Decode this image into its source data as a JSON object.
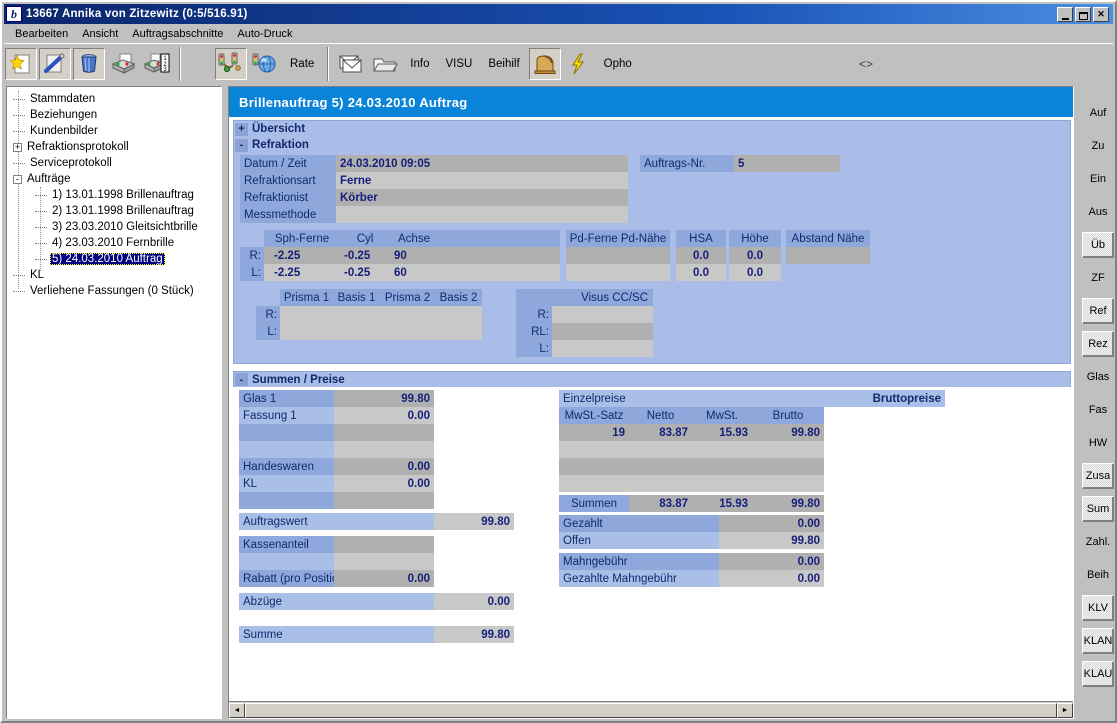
{
  "window": {
    "title": "13667  Annika von Zitzewitz   (0:5/516.91)",
    "icon": "app-icon",
    "buttons": {
      "minimize": "_",
      "maximize": "□",
      "close": "✕"
    }
  },
  "menubar": {
    "items": [
      "Bearbeiten",
      "Ansicht",
      "Auftragsabschnitte",
      "Auto-Druck"
    ]
  },
  "toolbar": {
    "icons": [
      {
        "name": "new-document-icon",
        "label": ""
      },
      {
        "name": "edit-pen-icon",
        "label": ""
      },
      {
        "name": "trash-bin-icon",
        "label": ""
      },
      {
        "name": "print-icon",
        "label": ""
      },
      {
        "name": "print-numbered-icon",
        "label": ""
      }
    ],
    "group2": [
      {
        "name": "traffic-light-network-icon",
        "label": ""
      },
      {
        "name": "globe-traffic-icon",
        "label": ""
      }
    ],
    "rate_label": "Rate",
    "group3": [
      {
        "name": "mail-envelope-icon",
        "label": ""
      },
      {
        "name": "folder-open-icon",
        "label": ""
      }
    ],
    "info_label": "Info",
    "visu_label": "VISU",
    "beihilf_label": "Beihilf",
    "lens-grinder_icon": "lens-grinder-icon",
    "lightning_icon": "lightning-icon",
    "opho_label": "Opho",
    "overflow_glyph": "<>"
  },
  "tree": {
    "items": [
      {
        "label": "Stammdaten",
        "level": 1,
        "toggle": "",
        "selected": false
      },
      {
        "label": "Beziehungen",
        "level": 1,
        "toggle": "",
        "selected": false
      },
      {
        "label": "Kundenbilder",
        "level": 1,
        "toggle": "",
        "selected": false
      },
      {
        "label": "Refraktionsprotokoll",
        "level": 1,
        "toggle": "+",
        "selected": false
      },
      {
        "label": "Serviceprotokoll",
        "level": 1,
        "toggle": "",
        "selected": false
      },
      {
        "label": "Aufträge",
        "level": 1,
        "toggle": "-",
        "selected": false
      },
      {
        "label": "1)  13.01.1998 Brillenauftrag",
        "level": 2,
        "toggle": "",
        "selected": false
      },
      {
        "label": "2)  13.01.1998 Brillenauftrag",
        "level": 2,
        "toggle": "",
        "selected": false
      },
      {
        "label": "3)  23.03.2010 Gleitsichtbrille",
        "level": 2,
        "toggle": "",
        "selected": false
      },
      {
        "label": "4)  23.03.2010 Fernbrille",
        "level": 2,
        "toggle": "",
        "selected": false
      },
      {
        "label": "5)  24.03.2010 Auftrag",
        "level": 2,
        "toggle": "",
        "selected": true
      },
      {
        "label": "KL",
        "level": 1,
        "toggle": "",
        "selected": false
      },
      {
        "label": "Verliehene Fassungen (0 Stück)",
        "level": 1,
        "toggle": "",
        "selected": false
      }
    ]
  },
  "document": {
    "header": "Brillenauftrag   5)  24.03.2010 Auftrag",
    "sections": {
      "uebersicht": {
        "toggle": "+",
        "title": "Übersicht"
      },
      "refraktion": {
        "toggle": "-",
        "title": "Refraktion"
      },
      "summen": {
        "toggle": "-",
        "title": "Summen / Preise"
      }
    }
  },
  "refraktion": {
    "fields": [
      {
        "label": "Datum / Zeit",
        "value": "24.03.2010 09:05"
      },
      {
        "label": "Refraktionsart",
        "value": "Ferne"
      },
      {
        "label": "Refraktionist",
        "value": "Körber"
      },
      {
        "label": "Messmethode",
        "value": ""
      }
    ],
    "auftrags_nr": {
      "label": "Auftrags-Nr.",
      "value": "5"
    },
    "values_table": {
      "headers": [
        "Sph-Ferne",
        "Cyl",
        "Achse",
        "",
        "Pd-Ferne Pd-Nähe",
        "HSA",
        "Höhe",
        "Abstand Nähe"
      ],
      "rows": [
        {
          "eye": "R:",
          "sph": "-2.25",
          "cyl": "-0.25",
          "achse": "90",
          "pd": "",
          "hsa": "0.0",
          "hoehe": "0.0",
          "abstand": ""
        },
        {
          "eye": "L:",
          "sph": "-2.25",
          "cyl": "-0.25",
          "achse": "60",
          "pd": "",
          "hsa": "0.0",
          "hoehe": "0.0",
          "abstand": ""
        }
      ]
    },
    "prisma": {
      "headers": [
        "Prisma 1",
        "Basis 1",
        "Prisma 2",
        "Basis 2"
      ],
      "rows": [
        {
          "eye": "R:",
          "p1": "",
          "b1": "",
          "p2": "",
          "b2": ""
        },
        {
          "eye": "L:",
          "p1": "",
          "b1": "",
          "p2": "",
          "b2": ""
        }
      ]
    },
    "visus": {
      "title": "Visus CC/SC",
      "rows": [
        {
          "eye": "R:",
          "value": ""
        },
        {
          "eye": "RL:",
          "value": ""
        },
        {
          "eye": "L:",
          "value": ""
        }
      ]
    }
  },
  "summen": {
    "left": {
      "positions": [
        {
          "label": "Glas 1",
          "value": "99.80"
        },
        {
          "label": "Fassung 1",
          "value": "0.00"
        },
        {
          "label": "",
          "value": ""
        },
        {
          "label": "",
          "value": ""
        },
        {
          "label": "Handeswaren",
          "value": "0.00"
        },
        {
          "label": "KL",
          "value": "0.00"
        },
        {
          "label": "",
          "value": ""
        }
      ],
      "auftragswert": {
        "label": "Auftragswert",
        "value": "99.80"
      },
      "kassen": [
        {
          "label": "Kassenanteil",
          "value": ""
        },
        {
          "label": "",
          "value": ""
        },
        {
          "label": "Rabatt (pro Position)",
          "value": "0.00"
        }
      ],
      "abzuege": {
        "label": "Abzüge",
        "value": "0.00"
      },
      "summe": {
        "label": "Summe",
        "value": "99.80"
      }
    },
    "right": {
      "einzelpreise_label": "Einzelpreise",
      "bruttopreise_label": "Bruttopreise",
      "table_headers": [
        "MwSt.-Satz",
        "Netto",
        "MwSt.",
        "Brutto"
      ],
      "table_rows": [
        {
          "satz": "19",
          "netto": "83.87",
          "mwst": "15.93",
          "brutto": "99.80"
        },
        {
          "satz": "",
          "netto": "",
          "mwst": "",
          "brutto": ""
        },
        {
          "satz": "",
          "netto": "",
          "mwst": "",
          "brutto": ""
        },
        {
          "satz": "",
          "netto": "",
          "mwst": "",
          "brutto": ""
        }
      ],
      "summen_row": {
        "label": "Summen",
        "netto": "83.87",
        "mwst": "15.93",
        "brutto": "99.80"
      },
      "gezahlt": {
        "label": "Gezahlt",
        "value": "0.00"
      },
      "offen": {
        "label": "Offen",
        "value": "99.80"
      },
      "mahngebuehr": {
        "label": "Mahngebühr",
        "value": "0.00"
      },
      "gezahlte_mahngebuehr": {
        "label": "Gezahlte Mahngebühr",
        "value": "0.00"
      }
    }
  },
  "rightbar": {
    "buttons": [
      {
        "label": "Auf",
        "raised": false
      },
      {
        "label": "Zu",
        "raised": false
      },
      {
        "label": "Ein",
        "raised": false
      },
      {
        "label": "Aus",
        "raised": false
      },
      {
        "label": "Üb",
        "raised": true
      },
      {
        "label": "ZF",
        "raised": false
      },
      {
        "label": "Ref",
        "raised": true
      },
      {
        "label": "Rez",
        "raised": true
      },
      {
        "label": "Glas",
        "raised": false
      },
      {
        "label": "Fas",
        "raised": false
      },
      {
        "label": "HW",
        "raised": false
      },
      {
        "label": "Zusa",
        "raised": true
      },
      {
        "label": "Sum",
        "raised": true
      },
      {
        "label": "Zahl.",
        "raised": false
      },
      {
        "label": "Beih",
        "raised": false
      },
      {
        "label": "KLV",
        "raised": true
      },
      {
        "label": "KLAN",
        "raised": true
      },
      {
        "label": "KLAU",
        "raised": true
      }
    ]
  },
  "scrollbar": {
    "left_arrow": "◄",
    "right_arrow": "►"
  },
  "colors": {
    "title_bar": "#0a246a",
    "doc_header": "#0a84d8",
    "section_bg": "#aabde8",
    "label_blue": "#8fa8dc",
    "value_gray": "#b0b0b0",
    "value_text": "#16207a",
    "selection": "#000080"
  }
}
